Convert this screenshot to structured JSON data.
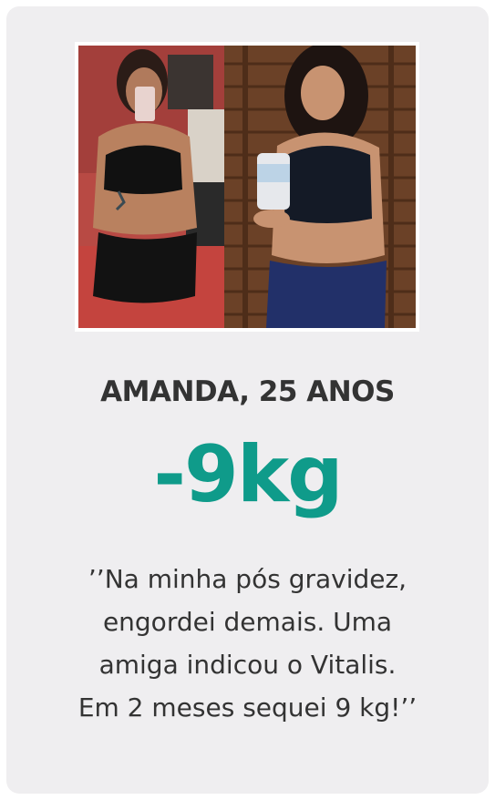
{
  "testimonial": {
    "name_age": "AMANDA, 25 ANOS",
    "weight_loss": "-9kg",
    "quote_lines": [
      "’’Na minha pós gravidez,",
      "engordei demais. Uma",
      "amiga indicou o Vitalis.",
      "Em 2 meses sequei 9 kg!’’"
    ]
  },
  "colors": {
    "card_background": "#efeef0",
    "accent_green": "#0f9b8a",
    "text_dark": "#333333"
  }
}
